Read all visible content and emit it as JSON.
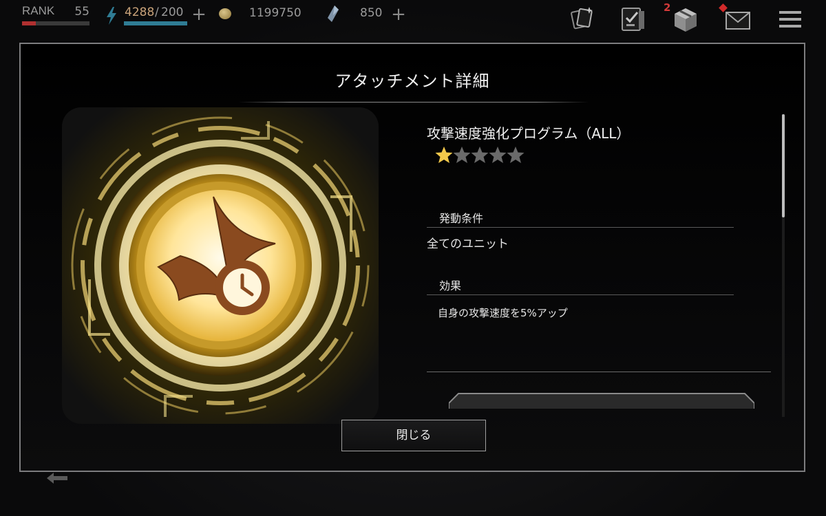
{
  "hud": {
    "rank_label": "RANK",
    "rank_value": "55",
    "rank_progress": 0.2,
    "stamina_current": "4288",
    "stamina_separator": "/",
    "stamina_max": "200",
    "stamina_progress": 1.0,
    "coins": "1199750",
    "gems": "850",
    "notification_count": "2",
    "icons": [
      "bolt-icon",
      "coin-icon",
      "crystal-icon",
      "gacha-cards-icon",
      "mission-checklist-icon",
      "present-box-icon",
      "mail-icon",
      "menu-icon"
    ]
  },
  "dialog": {
    "title": "アタッチメント詳細",
    "item_name": "攻撃速度強化プログラム（ALL）",
    "rarity": 1,
    "rarity_max": 5,
    "condition_header": "発動条件",
    "condition_value": "全てのユニット",
    "effect_header": "効果",
    "effect_value": "自身の攻撃速度を5%アップ",
    "close_label": "閉じる",
    "scroll_position": 0.0
  },
  "colors": {
    "accent_gold": "#f2c84b",
    "star_empty": "#6a6a6a",
    "rank_bar": "#b03030",
    "stamina_bar": "#2f7c94",
    "badge_red": "#d23a3a",
    "emblem_brown": "#8a4a1f"
  }
}
